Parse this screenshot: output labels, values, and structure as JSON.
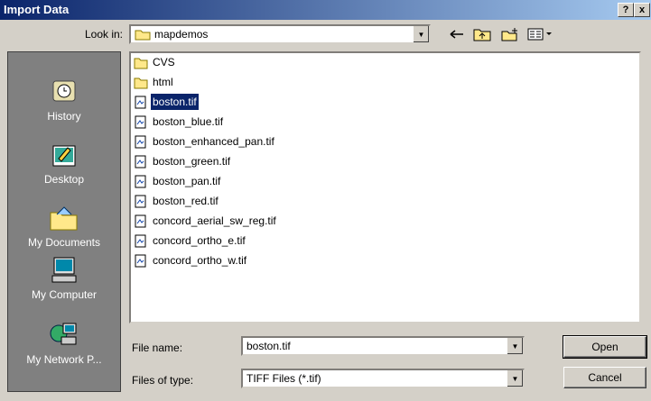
{
  "dialog": {
    "title": "Import Data"
  },
  "titlebar_buttons": {
    "help": "?",
    "close": "x"
  },
  "lookin": {
    "label": "Look in:",
    "value": "mapdemos"
  },
  "toolbar": {
    "icons": [
      "back-arrow-icon",
      "up-folder-icon",
      "new-folder-icon",
      "view-menu-icon"
    ]
  },
  "places": [
    {
      "label": "History",
      "icon": "history-icon"
    },
    {
      "label": "Desktop",
      "icon": "desktop-icon"
    },
    {
      "label": "My Documents",
      "icon": "my-documents-icon"
    },
    {
      "label": "My Computer",
      "icon": "my-computer-icon"
    },
    {
      "label": "My Network P...",
      "icon": "network-icon"
    }
  ],
  "files": [
    {
      "name": "CVS",
      "type": "folder"
    },
    {
      "name": "html",
      "type": "folder"
    },
    {
      "name": "boston.tif",
      "type": "file",
      "selected": true
    },
    {
      "name": "boston_blue.tif",
      "type": "file"
    },
    {
      "name": "boston_enhanced_pan.tif",
      "type": "file"
    },
    {
      "name": "boston_green.tif",
      "type": "file"
    },
    {
      "name": "boston_pan.tif",
      "type": "file"
    },
    {
      "name": "boston_red.tif",
      "type": "file"
    },
    {
      "name": "concord_aerial_sw_reg.tif",
      "type": "file"
    },
    {
      "name": "concord_ortho_e.tif",
      "type": "file"
    },
    {
      "name": "concord_ortho_w.tif",
      "type": "file"
    }
  ],
  "filename": {
    "label": "File name:",
    "value": "boston.tif"
  },
  "filetype": {
    "label": "Files of type:",
    "value": "TIFF Files (*.tif)"
  },
  "buttons": {
    "open": "Open",
    "cancel": "Cancel"
  }
}
